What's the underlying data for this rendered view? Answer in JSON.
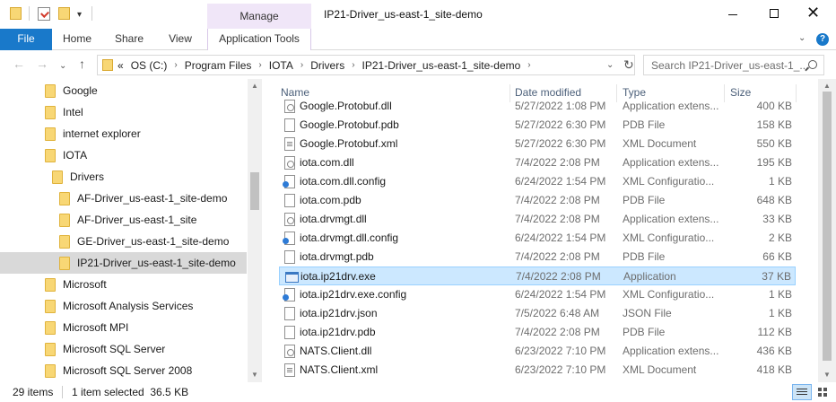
{
  "window": {
    "title": "IP21-Driver_us-east-1_site-demo",
    "manage_tab": "Manage",
    "minimize": "—",
    "maximize": "☐",
    "close": "✕"
  },
  "ribbon": {
    "file": "File",
    "tabs": [
      "Home",
      "Share",
      "View"
    ],
    "app_tools": "Application Tools",
    "chevron": "⌄",
    "help": "?"
  },
  "address": {
    "prefix": "«",
    "crumbs": [
      "OS (C:)",
      "Program Files",
      "IOTA",
      "Drivers",
      "IP21-Driver_us-east-1_site-demo"
    ],
    "search_placeholder": "Search IP21-Driver_us-east-1_..."
  },
  "nav": {
    "back": "←",
    "forward": "→",
    "recent": "⌄",
    "up": "↑",
    "refresh": "↻",
    "dropdown": "⌄"
  },
  "navigation_pane": {
    "items": [
      {
        "label": "Google",
        "indent": 0
      },
      {
        "label": "Intel",
        "indent": 0
      },
      {
        "label": "internet explorer",
        "indent": 0
      },
      {
        "label": "IOTA",
        "indent": 0
      },
      {
        "label": "Drivers",
        "indent": 1
      },
      {
        "label": "AF-Driver_us-east-1_site-demo",
        "indent": 2
      },
      {
        "label": "AF-Driver_us-east-1_site",
        "indent": 2
      },
      {
        "label": "GE-Driver_us-east-1_site-demo",
        "indent": 2
      },
      {
        "label": "IP21-Driver_us-east-1_site-demo",
        "indent": 2,
        "selected": true
      },
      {
        "label": "Microsoft",
        "indent": 0
      },
      {
        "label": "Microsoft Analysis Services",
        "indent": 0
      },
      {
        "label": "Microsoft MPI",
        "indent": 0
      },
      {
        "label": "Microsoft SQL Server",
        "indent": 0
      },
      {
        "label": "Microsoft SQL Server 2008",
        "indent": 0
      }
    ]
  },
  "columns": {
    "name": "Name",
    "date": "Date modified",
    "type": "Type",
    "size": "Size"
  },
  "files": [
    {
      "name": "Google.Protobuf.dll",
      "date": "5/27/2022 1:08 PM",
      "type": "Application extens...",
      "size": "400 KB",
      "icon": "dll"
    },
    {
      "name": "Google.Protobuf.pdb",
      "date": "5/27/2022 6:30 PM",
      "type": "PDB File",
      "size": "158 KB",
      "icon": "doc"
    },
    {
      "name": "Google.Protobuf.xml",
      "date": "5/27/2022 6:30 PM",
      "type": "XML Document",
      "size": "550 KB",
      "icon": "xml"
    },
    {
      "name": "iota.com.dll",
      "date": "7/4/2022 2:08 PM",
      "type": "Application extens...",
      "size": "195 KB",
      "icon": "dll"
    },
    {
      "name": "iota.com.dll.config",
      "date": "6/24/2022 1:54 PM",
      "type": "XML Configuratio...",
      "size": "1 KB",
      "icon": "config"
    },
    {
      "name": "iota.com.pdb",
      "date": "7/4/2022 2:08 PM",
      "type": "PDB File",
      "size": "648 KB",
      "icon": "doc"
    },
    {
      "name": "iota.drvmgt.dll",
      "date": "7/4/2022 2:08 PM",
      "type": "Application extens...",
      "size": "33 KB",
      "icon": "dll"
    },
    {
      "name": "iota.drvmgt.dll.config",
      "date": "6/24/2022 1:54 PM",
      "type": "XML Configuratio...",
      "size": "2 KB",
      "icon": "config"
    },
    {
      "name": "iota.drvmgt.pdb",
      "date": "7/4/2022 2:08 PM",
      "type": "PDB File",
      "size": "66 KB",
      "icon": "doc"
    },
    {
      "name": "iota.ip21drv.exe",
      "date": "7/4/2022 2:08 PM",
      "type": "Application",
      "size": "37 KB",
      "icon": "exe",
      "selected": true
    },
    {
      "name": "iota.ip21drv.exe.config",
      "date": "6/24/2022 1:54 PM",
      "type": "XML Configuratio...",
      "size": "1 KB",
      "icon": "config"
    },
    {
      "name": "iota.ip21drv.json",
      "date": "7/5/2022 6:48 AM",
      "type": "JSON File",
      "size": "1 KB",
      "icon": "doc"
    },
    {
      "name": "iota.ip21drv.pdb",
      "date": "7/4/2022 2:08 PM",
      "type": "PDB File",
      "size": "112 KB",
      "icon": "doc"
    },
    {
      "name": "NATS.Client.dll",
      "date": "6/23/2022 7:10 PM",
      "type": "Application extens...",
      "size": "436 KB",
      "icon": "dll"
    },
    {
      "name": "NATS.Client.xml",
      "date": "6/23/2022 7:10 PM",
      "type": "XML Document",
      "size": "418 KB",
      "icon": "xml"
    }
  ],
  "status": {
    "count": "29 items",
    "selection": "1 item selected  36.5 KB"
  },
  "scroll": {
    "up": "▲",
    "down": "▼"
  }
}
